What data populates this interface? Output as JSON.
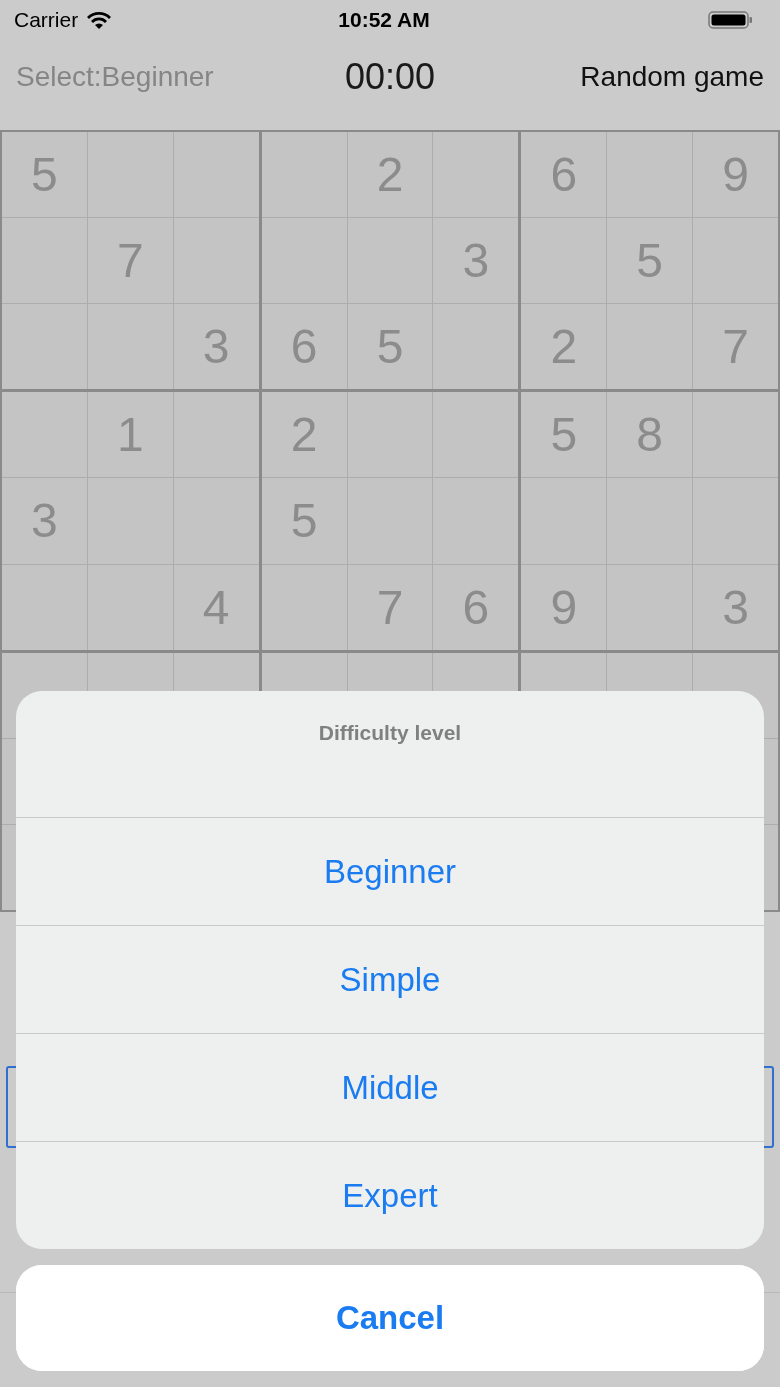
{
  "status_bar": {
    "carrier": "Carrier",
    "time": "10:52 AM"
  },
  "header": {
    "selection": "Select:Beginner",
    "timer": "00:00",
    "random_button": "Random game"
  },
  "board": {
    "rows": [
      [
        "5",
        null,
        null,
        null,
        "2",
        null,
        "6",
        null,
        "9"
      ],
      [
        null,
        "7",
        null,
        null,
        null,
        "3",
        null,
        "5",
        null
      ],
      [
        null,
        null,
        "3",
        "6",
        "5",
        null,
        "2",
        null,
        "7"
      ],
      [
        null,
        "1",
        null,
        "2",
        null,
        null,
        "5",
        "8",
        null
      ],
      [
        "3",
        null,
        null,
        "5",
        null,
        null,
        null,
        null,
        null
      ],
      [
        null,
        null,
        "4",
        null,
        "7",
        "6",
        "9",
        null,
        "3"
      ]
    ]
  },
  "action_sheet": {
    "title": "Difficulty level",
    "options": [
      "Beginner",
      "Simple",
      "Middle",
      "Expert"
    ],
    "cancel": "Cancel"
  }
}
